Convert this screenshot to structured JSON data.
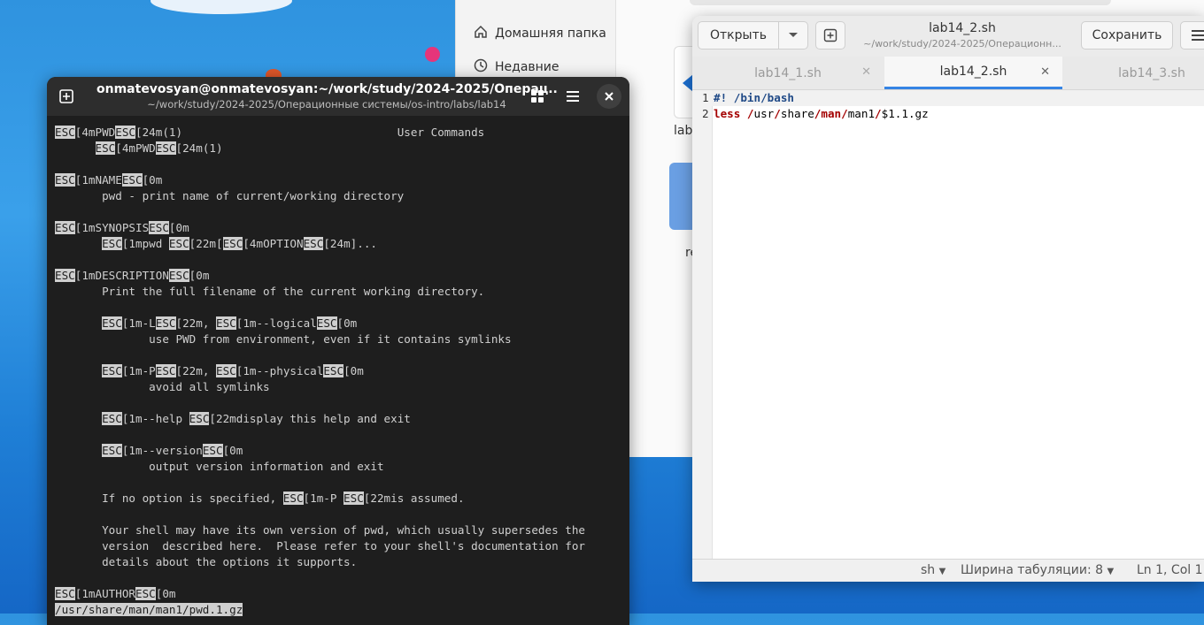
{
  "files": {
    "sidebar": [
      {
        "label": "Домашняя папка",
        "icon": "home-icon"
      },
      {
        "label": "Недавние",
        "icon": "clock-icon"
      }
    ],
    "tiles": [
      {
        "label": "lab1"
      },
      {
        "label": "re"
      }
    ]
  },
  "terminal": {
    "title": "onmatevosyan@onmatevosyan:~/work/study/2024-2025/Операц...",
    "subtitle": "~/work/study/2024-2025/Операционные системы/os-intro/labs/lab14",
    "lines": [
      [
        {
          "e": 1,
          "t": "ESC"
        },
        {
          "t": "[4mPWD"
        },
        {
          "e": 1,
          "t": "ESC"
        },
        {
          "t": "[24m(1)                                User Commands"
        }
      ],
      [
        {
          "t": "      "
        },
        {
          "e": 1,
          "t": "ESC"
        },
        {
          "t": "[4mPWD"
        },
        {
          "e": 1,
          "t": "ESC"
        },
        {
          "t": "[24m(1)"
        }
      ],
      [],
      [
        {
          "e": 1,
          "t": "ESC"
        },
        {
          "t": "[1mNAME"
        },
        {
          "e": 1,
          "t": "ESC"
        },
        {
          "t": "[0m"
        }
      ],
      [
        {
          "t": "       pwd - print name of current/working directory"
        }
      ],
      [],
      [
        {
          "e": 1,
          "t": "ESC"
        },
        {
          "t": "[1mSYNOPSIS"
        },
        {
          "e": 1,
          "t": "ESC"
        },
        {
          "t": "[0m"
        }
      ],
      [
        {
          "t": "       "
        },
        {
          "e": 1,
          "t": "ESC"
        },
        {
          "t": "[1mpwd "
        },
        {
          "e": 1,
          "t": "ESC"
        },
        {
          "t": "[22m["
        },
        {
          "e": 1,
          "t": "ESC"
        },
        {
          "t": "[4mOPTION"
        },
        {
          "e": 1,
          "t": "ESC"
        },
        {
          "t": "[24m]..."
        }
      ],
      [],
      [
        {
          "e": 1,
          "t": "ESC"
        },
        {
          "t": "[1mDESCRIPTION"
        },
        {
          "e": 1,
          "t": "ESC"
        },
        {
          "t": "[0m"
        }
      ],
      [
        {
          "t": "       Print the full filename of the current working directory."
        }
      ],
      [],
      [
        {
          "t": "       "
        },
        {
          "e": 1,
          "t": "ESC"
        },
        {
          "t": "[1m-L"
        },
        {
          "e": 1,
          "t": "ESC"
        },
        {
          "t": "[22m, "
        },
        {
          "e": 1,
          "t": "ESC"
        },
        {
          "t": "[1m--logical"
        },
        {
          "e": 1,
          "t": "ESC"
        },
        {
          "t": "[0m"
        }
      ],
      [
        {
          "t": "              use PWD from environment, even if it contains symlinks"
        }
      ],
      [],
      [
        {
          "t": "       "
        },
        {
          "e": 1,
          "t": "ESC"
        },
        {
          "t": "[1m-P"
        },
        {
          "e": 1,
          "t": "ESC"
        },
        {
          "t": "[22m, "
        },
        {
          "e": 1,
          "t": "ESC"
        },
        {
          "t": "[1m--physical"
        },
        {
          "e": 1,
          "t": "ESC"
        },
        {
          "t": "[0m"
        }
      ],
      [
        {
          "t": "              avoid all symlinks"
        }
      ],
      [],
      [
        {
          "t": "       "
        },
        {
          "e": 1,
          "t": "ESC"
        },
        {
          "t": "[1m--help "
        },
        {
          "e": 1,
          "t": "ESC"
        },
        {
          "t": "[22mdisplay this help and exit"
        }
      ],
      [],
      [
        {
          "t": "       "
        },
        {
          "e": 1,
          "t": "ESC"
        },
        {
          "t": "[1m--version"
        },
        {
          "e": 1,
          "t": "ESC"
        },
        {
          "t": "[0m"
        }
      ],
      [
        {
          "t": "              output version information and exit"
        }
      ],
      [],
      [
        {
          "t": "       If no option is specified, "
        },
        {
          "e": 1,
          "t": "ESC"
        },
        {
          "t": "[1m-P "
        },
        {
          "e": 1,
          "t": "ESC"
        },
        {
          "t": "[22mis assumed."
        }
      ],
      [],
      [
        {
          "t": "       Your shell may have its own version of pwd, which usually supersedes the"
        }
      ],
      [
        {
          "t": "       version  described here.  Please refer to your shell's documentation for"
        }
      ],
      [
        {
          "t": "       details about the options it supports."
        }
      ],
      [],
      [
        {
          "e": 1,
          "t": "ESC"
        },
        {
          "t": "[1mAUTHOR"
        },
        {
          "e": 1,
          "t": "ESC"
        },
        {
          "t": "[0m"
        }
      ],
      [
        {
          "h": 1,
          "t": "/usr/share/man/man1/pwd.1.gz"
        }
      ]
    ]
  },
  "editor": {
    "open_label": "Открыть",
    "save_label": "Сохранить",
    "title": "lab14_2.sh",
    "path": "~/work/study/2024-2025/Операционн...",
    "tabs": [
      {
        "label": "lab14_1.sh",
        "active": false
      },
      {
        "label": "lab14_2.sh",
        "active": true
      },
      {
        "label": "lab14_3.sh",
        "active": false
      }
    ],
    "code": [
      {
        "n": "1",
        "parts": [
          {
            "c": "blue",
            "t": "#! /bin/bash"
          }
        ]
      },
      {
        "n": "2",
        "parts": [
          {
            "c": "red",
            "t": "less "
          },
          {
            "c": "red",
            "t": "/"
          },
          {
            "t": "usr"
          },
          {
            "c": "red",
            "t": "/"
          },
          {
            "t": "share"
          },
          {
            "c": "red",
            "t": "/man/"
          },
          {
            "t": "man1"
          },
          {
            "c": "red",
            "t": "/"
          },
          {
            "t": "$1.1.gz"
          }
        ]
      }
    ],
    "status": {
      "language": "sh",
      "tab_width": "Ширина табуляции: 8",
      "position": "Ln 1, Col 1"
    }
  }
}
